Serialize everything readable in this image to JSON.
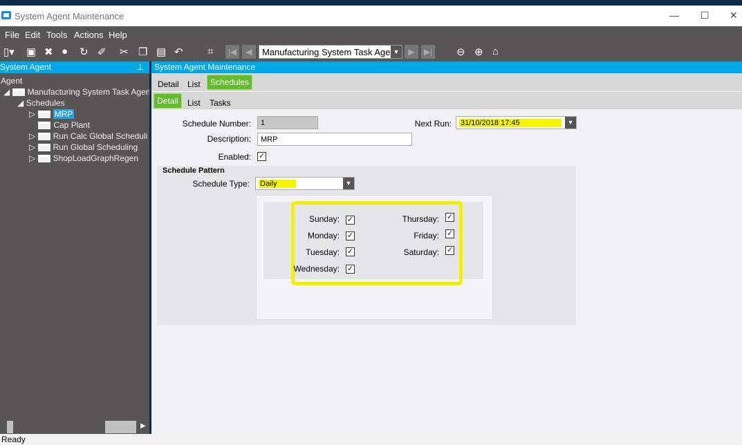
{
  "window": {
    "title": "System Agent Maintenance",
    "minimize": "—",
    "maximize": "☐",
    "close": "✕"
  },
  "menu": [
    "File",
    "Edit",
    "Tools",
    "Actions",
    "Help"
  ],
  "toolbar": {
    "nav_value": "Manufacturing System Task Agen"
  },
  "left_panel": {
    "title": "System Agent",
    "pin": "⊥",
    "tree": {
      "root": "Agent",
      "agent": "Manufacturing System Task Agent",
      "schedules": "Schedules",
      "items": [
        "MRP",
        "Cap Plant",
        "Run Calc Global Scheduli",
        "Run Global Scheduling",
        "ShopLoadGraphRegen"
      ]
    }
  },
  "right_panel": {
    "title": "System Agent Maintenance",
    "tabs": [
      "Detail",
      "List",
      "Schedules"
    ],
    "active_tab": "Schedules",
    "subtabs": [
      "Detail",
      "List",
      "Tasks"
    ],
    "active_subtab": "Detail",
    "form": {
      "schedule_number_label": "Schedule Number:",
      "schedule_number": "1",
      "description_label": "Description:",
      "description": "MRP",
      "enabled_label": "Enabled:",
      "enabled": true,
      "next_run_label": "Next Run:",
      "next_run": "31/10/2018 17:45",
      "pattern_title": "Schedule Pattern",
      "schedule_type_label": "Schedule Type:",
      "schedule_type": "Daily",
      "days": [
        {
          "label": "Sunday:",
          "checked": true
        },
        {
          "label": "Monday:",
          "checked": true
        },
        {
          "label": "Tuesday:",
          "checked": true
        },
        {
          "label": "Wednesday:",
          "checked": true
        },
        {
          "label": "Thursday:",
          "checked": true
        },
        {
          "label": "Friday:",
          "checked": true
        },
        {
          "label": "Saturday:",
          "checked": true
        }
      ]
    }
  },
  "status": "Ready",
  "colors": {
    "accent": "#00a8e8",
    "tab_active": "#65bb2f",
    "highlight": "#f4f400",
    "chrome": "#585654"
  }
}
